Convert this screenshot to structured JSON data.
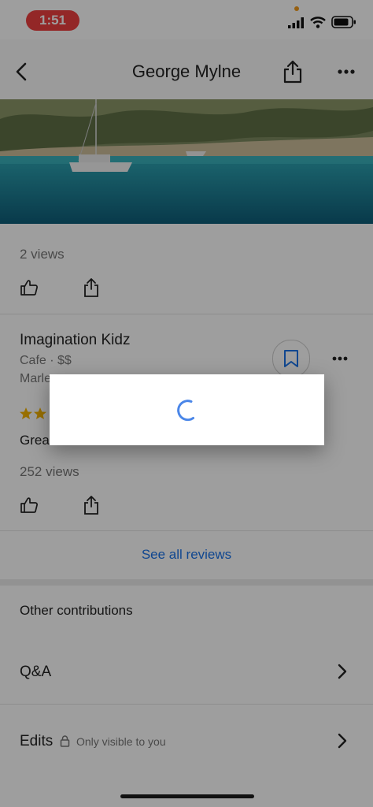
{
  "status_bar": {
    "time": "1:51"
  },
  "header": {
    "title": "George Mylne"
  },
  "photo_card": {
    "views": "2 views"
  },
  "review": {
    "place_name": "Imagination Kidz",
    "category": "Cafe · $$",
    "location_partial": "Marle",
    "rating_stars": 3,
    "text_partial": "Grea",
    "views": "252 views"
  },
  "see_all_reviews": "See all reviews",
  "other_contributions": {
    "heading": "Other contributions",
    "items": [
      {
        "label": "Q&A"
      },
      {
        "label": "Edits",
        "note": "Only visible to you"
      }
    ]
  },
  "colors": {
    "accent": "#1a73e8",
    "star": "#f5b400",
    "time_pill": "#ee4040"
  }
}
